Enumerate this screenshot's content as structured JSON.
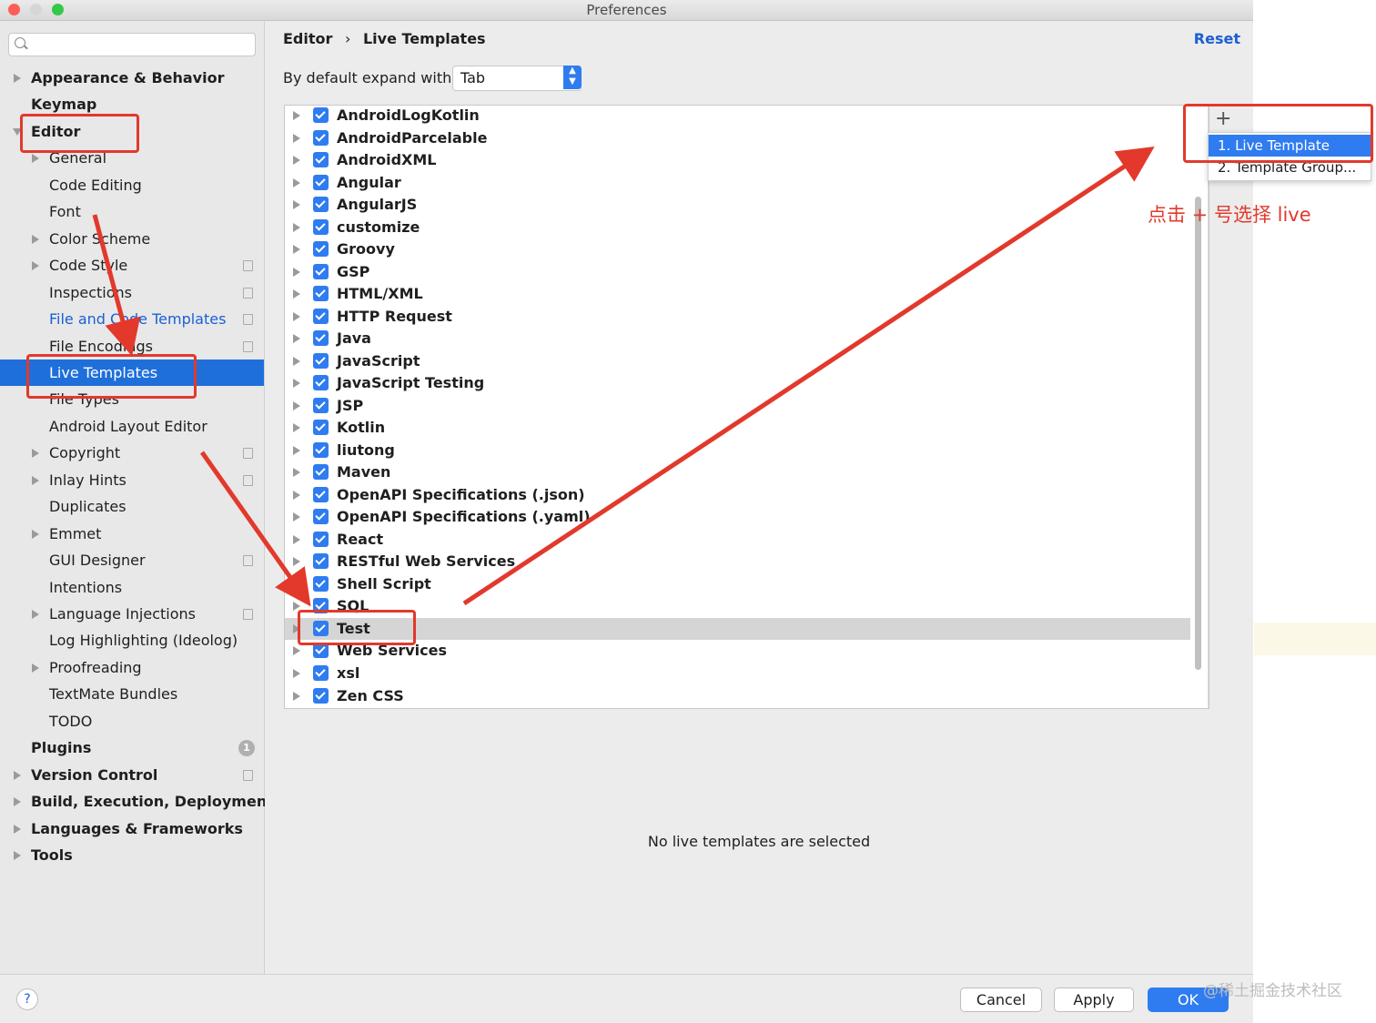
{
  "window": {
    "title": "Preferences"
  },
  "sidebar": {
    "search_placeholder": "",
    "items": [
      {
        "label": "Appearance & Behavior",
        "bold": true,
        "arrow": true,
        "depth": 0
      },
      {
        "label": "Keymap",
        "bold": true,
        "arrow": false,
        "depth": 0
      },
      {
        "label": "Editor",
        "bold": true,
        "arrow": true,
        "depth": 0,
        "expanded": true
      },
      {
        "label": "General",
        "arrow": true,
        "depth": 1
      },
      {
        "label": "Code Editing",
        "arrow": false,
        "depth": 1
      },
      {
        "label": "Font",
        "arrow": false,
        "depth": 1
      },
      {
        "label": "Color Scheme",
        "arrow": true,
        "depth": 1
      },
      {
        "label": "Code Style",
        "arrow": true,
        "depth": 1,
        "copy_icon": true
      },
      {
        "label": "Inspections",
        "arrow": false,
        "depth": 1,
        "copy_icon": true
      },
      {
        "label": "File and Code Templates",
        "arrow": false,
        "depth": 1,
        "copy_icon": true,
        "link": true
      },
      {
        "label": "File Encodings",
        "arrow": false,
        "depth": 1,
        "copy_icon": true
      },
      {
        "label": "Live Templates",
        "arrow": false,
        "depth": 1,
        "selected": true
      },
      {
        "label": "File Types",
        "arrow": false,
        "depth": 1
      },
      {
        "label": "Android Layout Editor",
        "arrow": false,
        "depth": 1
      },
      {
        "label": "Copyright",
        "arrow": true,
        "depth": 1,
        "copy_icon": true
      },
      {
        "label": "Inlay Hints",
        "arrow": true,
        "depth": 1,
        "copy_icon": true
      },
      {
        "label": "Duplicates",
        "arrow": false,
        "depth": 1
      },
      {
        "label": "Emmet",
        "arrow": true,
        "depth": 1
      },
      {
        "label": "GUI Designer",
        "arrow": false,
        "depth": 1,
        "copy_icon": true
      },
      {
        "label": "Intentions",
        "arrow": false,
        "depth": 1
      },
      {
        "label": "Language Injections",
        "arrow": true,
        "depth": 1,
        "copy_icon": true
      },
      {
        "label": "Log Highlighting (Ideolog)",
        "arrow": false,
        "depth": 1
      },
      {
        "label": "Proofreading",
        "arrow": true,
        "depth": 1
      },
      {
        "label": "TextMate Bundles",
        "arrow": false,
        "depth": 1
      },
      {
        "label": "TODO",
        "arrow": false,
        "depth": 1
      },
      {
        "label": "Plugins",
        "bold": true,
        "arrow": false,
        "depth": 0,
        "badge": "1"
      },
      {
        "label": "Version Control",
        "bold": true,
        "arrow": true,
        "depth": 0,
        "copy_icon": true
      },
      {
        "label": "Build, Execution, Deployment",
        "bold": true,
        "arrow": true,
        "depth": 0
      },
      {
        "label": "Languages & Frameworks",
        "bold": true,
        "arrow": true,
        "depth": 0
      },
      {
        "label": "Tools",
        "bold": true,
        "arrow": true,
        "depth": 0
      }
    ]
  },
  "header": {
    "breadcrumb_parent": "Editor",
    "breadcrumb_sep": "›",
    "breadcrumb_current": "Live Templates",
    "reset_label": "Reset"
  },
  "expand": {
    "label": "By default expand with",
    "value": "Tab"
  },
  "templates": {
    "groups": [
      "AndroidLogKotlin",
      "AndroidParcelable",
      "AndroidXML",
      "Angular",
      "AngularJS",
      "customize",
      "Groovy",
      "GSP",
      "HTML/XML",
      "HTTP Request",
      "Java",
      "JavaScript",
      "JavaScript Testing",
      "JSP",
      "Kotlin",
      "liutong",
      "Maven",
      "OpenAPI Specifications (.json)",
      "OpenAPI Specifications (.yaml)",
      "React",
      "RESTful Web Services",
      "Shell Script",
      "SQL",
      "Test",
      "Web Services",
      "xsl",
      "Zen CSS"
    ],
    "highlighted": "Test",
    "add_label": "+",
    "empty_message": "No live templates are selected"
  },
  "popup": {
    "items": [
      "1. Live Template",
      "2. Template Group..."
    ]
  },
  "annotation": {
    "note": "点击 + 号选择 live",
    "color": "#e2392c"
  },
  "footer": {
    "help": "?",
    "cancel": "Cancel",
    "apply": "Apply",
    "ok": "OK"
  },
  "watermark": "@稀土掘金技术社区",
  "colors": {
    "accent": "#2f7cf0",
    "selection": "#1f6fdb",
    "annotation": "#e2392c"
  }
}
